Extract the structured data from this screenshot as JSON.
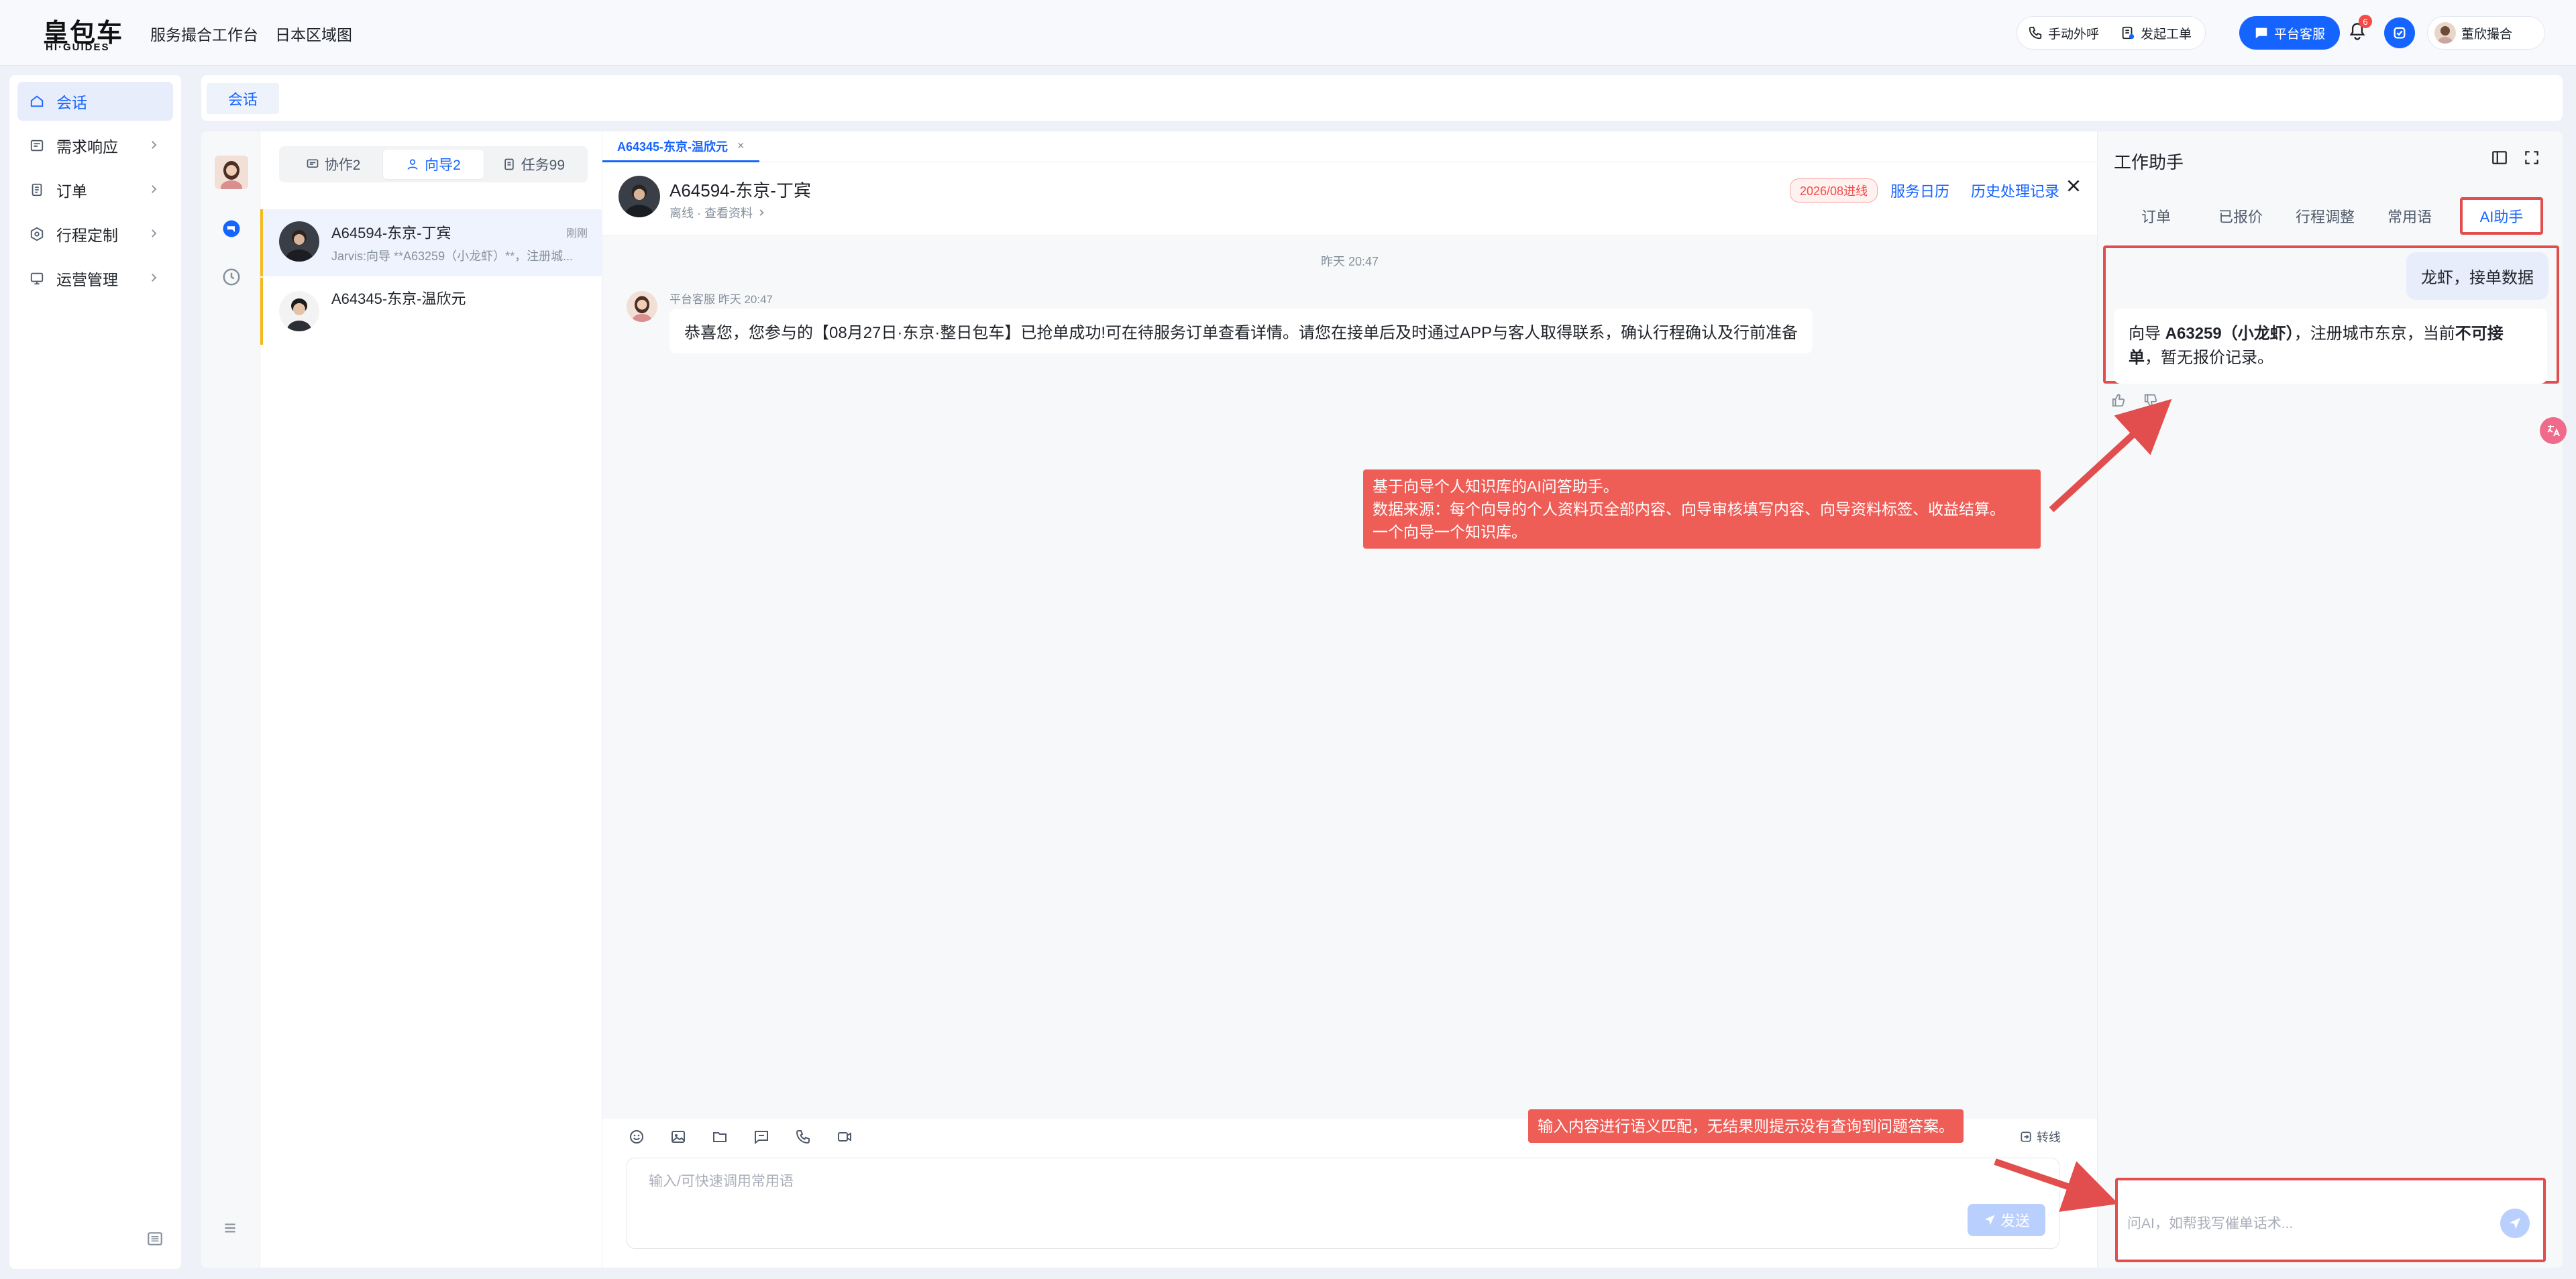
{
  "app": {
    "logo_cn": "皇包车",
    "logo_en": "HI·GUIDES",
    "nav": [
      "服务撮合工作台",
      "日本区域图"
    ],
    "actions": {
      "call": "手动外呼",
      "ticket": "发起工单",
      "platform_service": "平台客服"
    },
    "notification_count": "6",
    "user_name": "董欣撮合"
  },
  "sidebar": {
    "items": [
      {
        "label": "会话",
        "icon": "home-icon",
        "active": true
      },
      {
        "label": "需求响应",
        "icon": "demand-icon"
      },
      {
        "label": "订单",
        "icon": "order-icon"
      },
      {
        "label": "行程定制",
        "icon": "itinerary-icon"
      },
      {
        "label": "运营管理",
        "icon": "operations-icon"
      }
    ]
  },
  "page_tabs": [
    "会话"
  ],
  "conversations": {
    "segments": [
      {
        "label": "协作2",
        "icon": "chat-icon"
      },
      {
        "label": "向导2",
        "icon": "user-icon",
        "active": true
      },
      {
        "label": "任务99",
        "icon": "task-icon"
      }
    ],
    "items": [
      {
        "name": "A64594-东京-丁宾",
        "time": "刚刚",
        "preview": "Jarvis:向导 **A63259（小龙虾）**，注册城..."
      },
      {
        "name": "A64345-东京-温欣元",
        "time": "",
        "preview": ""
      }
    ]
  },
  "chat": {
    "tab_label": "A64345-东京-温欣元",
    "contact_name": "A64594-东京-丁宾",
    "contact_status": "离线 · 查看资料",
    "tag": "2026/08进线",
    "links": [
      "服务日历",
      "历史处理记录"
    ],
    "time_divider": "昨天 20:47",
    "messages": [
      {
        "sender": "平台客服  昨天 20:47",
        "text": "恭喜您，您参与的【08月27日·东京·整日包车】已抢单成功!可在待服务订单查看详情。请您在接单后及时通过APP与客人取得联系，确认行程确认及行前准备"
      }
    ],
    "transfer_label": "转线",
    "input_placeholder": "输入/可快速调用常用语",
    "send_label": "发送"
  },
  "assistant": {
    "title": "工作助手",
    "tabs": [
      "订单",
      "已报价",
      "行程调整",
      "常用语",
      "AI助手"
    ],
    "active_tab": "AI助手",
    "user_message": "龙虾，接单数据",
    "reply": {
      "p1": "向导 ",
      "b1": "A63259（小龙虾）",
      "p2": "，注册城市东京，当前",
      "b2": "不可接单",
      "p3": "，暂无报价记录。"
    },
    "input_placeholder": "问AI，如帮我写催单话术..."
  },
  "annotations": {
    "note1": [
      "基于向导个人知识库的AI问答助手。",
      "数据来源：每个向导的个人资料页全部内容、向导审核填写内容、向导资料标签、收益结算。",
      "一个向导一个知识库。"
    ],
    "note2": "输入内容进行语义匹配，无结果则提示没有查询到问题答案。"
  },
  "colors": {
    "accent": "#1664ff",
    "annotation_red": "#e24d4d",
    "tag_red": "#f54a45",
    "conv_marker": "#f7ba1e"
  }
}
